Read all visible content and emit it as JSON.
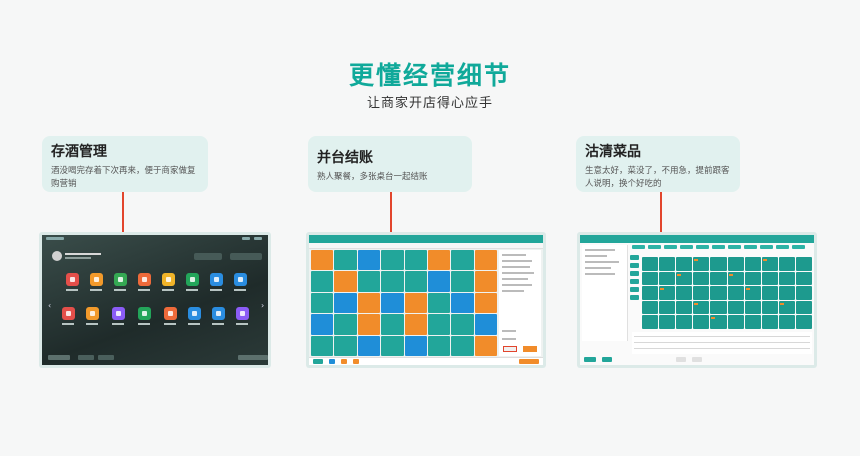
{
  "header": {
    "title": "更懂经营细节",
    "subtitle": "让商家开店得心应手"
  },
  "features": [
    {
      "title": "存酒管理",
      "desc": "酒没喝完存着下次再来，便于商家做复购营销"
    },
    {
      "title": "并台结账",
      "desc": "熟人聚餐，多张桌台一起结账"
    },
    {
      "title": "沽清菜品",
      "desc": "生意太好，菜没了，不用急，提前跟客人说明，换个好吃的"
    }
  ],
  "colors": {
    "accent": "#10a99a",
    "connector": "#e2452d",
    "card_bg": "#e1f1ef",
    "orange": "#f18c2a",
    "blue": "#1f8ed8",
    "teal": "#22a69a"
  }
}
